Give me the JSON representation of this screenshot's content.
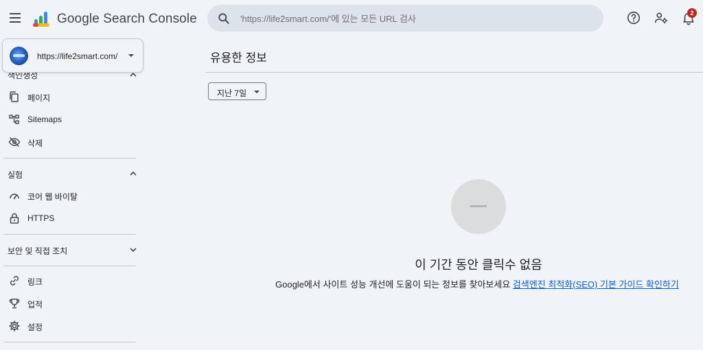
{
  "header": {
    "app_title": "Google Search Console",
    "search_placeholder": "'https://life2smart.com/'에 있는 모든 URL 검사",
    "notification_count": "2"
  },
  "property": {
    "url": "https://life2smart.com/"
  },
  "sidebar": {
    "indexing_label": "색인생성",
    "indexing_items": [
      {
        "label": "페이지",
        "icon": "pages-icon"
      },
      {
        "label": "Sitemaps",
        "icon": "sitemap-icon"
      },
      {
        "label": "삭제",
        "icon": "eye-off-icon"
      }
    ],
    "experience_label": "실험",
    "experience_items": [
      {
        "label": "코어 웹 바이탈",
        "icon": "speedometer-icon"
      },
      {
        "label": "HTTPS",
        "icon": "lock-icon"
      }
    ],
    "security_label": "보안 및 직접 조치",
    "other_items": [
      {
        "label": "링크",
        "icon": "link-icon"
      },
      {
        "label": "업적",
        "icon": "trophy-icon"
      },
      {
        "label": "설정",
        "icon": "gear-icon"
      }
    ]
  },
  "main": {
    "title": "유용한 정보",
    "date_range": "지난 7일",
    "empty_title": "이 기간 동안 클릭수 없음",
    "empty_desc": "Google에서 사이트 성능 개선에 도움이 되는 정보를 찾아보세요",
    "empty_link": "검색엔진 최적화(SEO) 기본 가이드 확인하기"
  },
  "colors": {
    "background": "#f0f4f9",
    "search_bg": "#dde3ea",
    "link": "#0b57d0",
    "badge": "#c5221f"
  }
}
